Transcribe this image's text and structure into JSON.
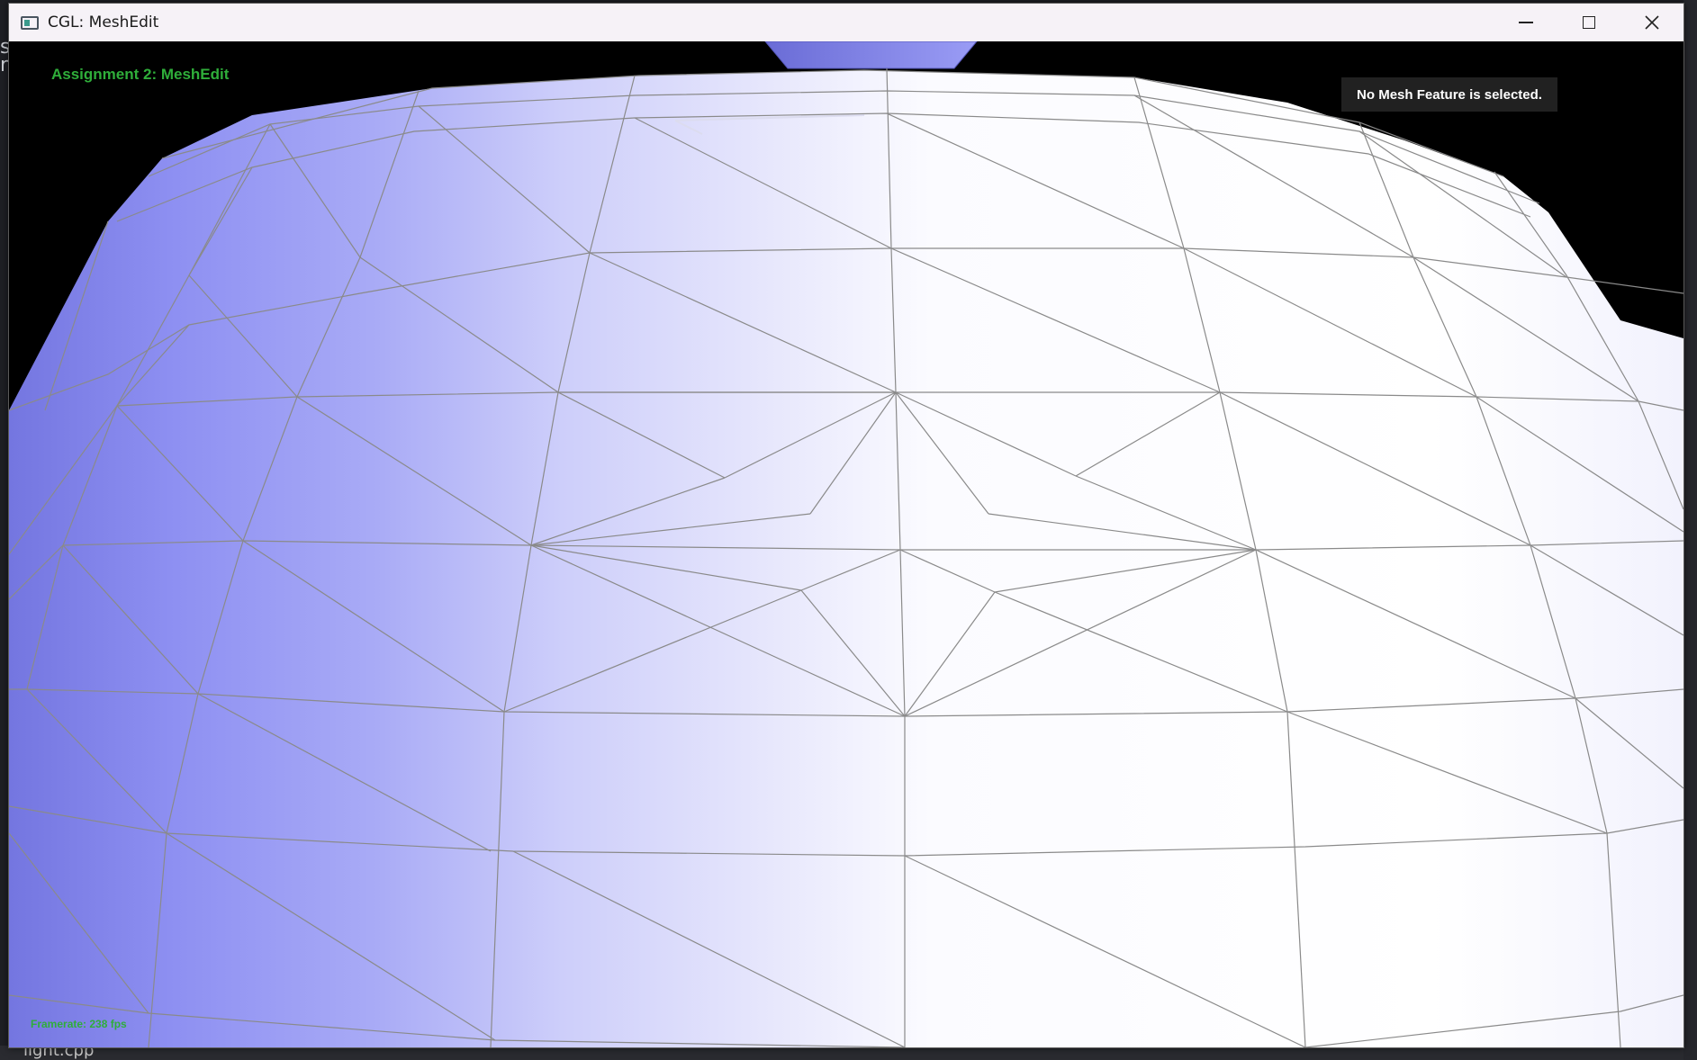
{
  "window": {
    "title": "CGL: MeshEdit",
    "controls": [
      "minimize",
      "maximize",
      "close"
    ]
  },
  "hud": {
    "assignment_title": "Assignment 2: MeshEdit",
    "selection_status": "No Mesh Feature is selected.",
    "framerate": "Framerate: 238 fps"
  },
  "background": {
    "taskbar_file": "light.cpp"
  },
  "colors": {
    "hud_text": "#2fae3a",
    "mesh_shaded": "#8f91f0",
    "mesh_lit": "#ffffff",
    "wireframe": "#8a8a8a",
    "viewport_bg": "#000000"
  },
  "icons": {
    "app": "cgl-app-icon",
    "minimize": "minimize-icon",
    "maximize": "maximize-icon",
    "close": "close-icon"
  }
}
